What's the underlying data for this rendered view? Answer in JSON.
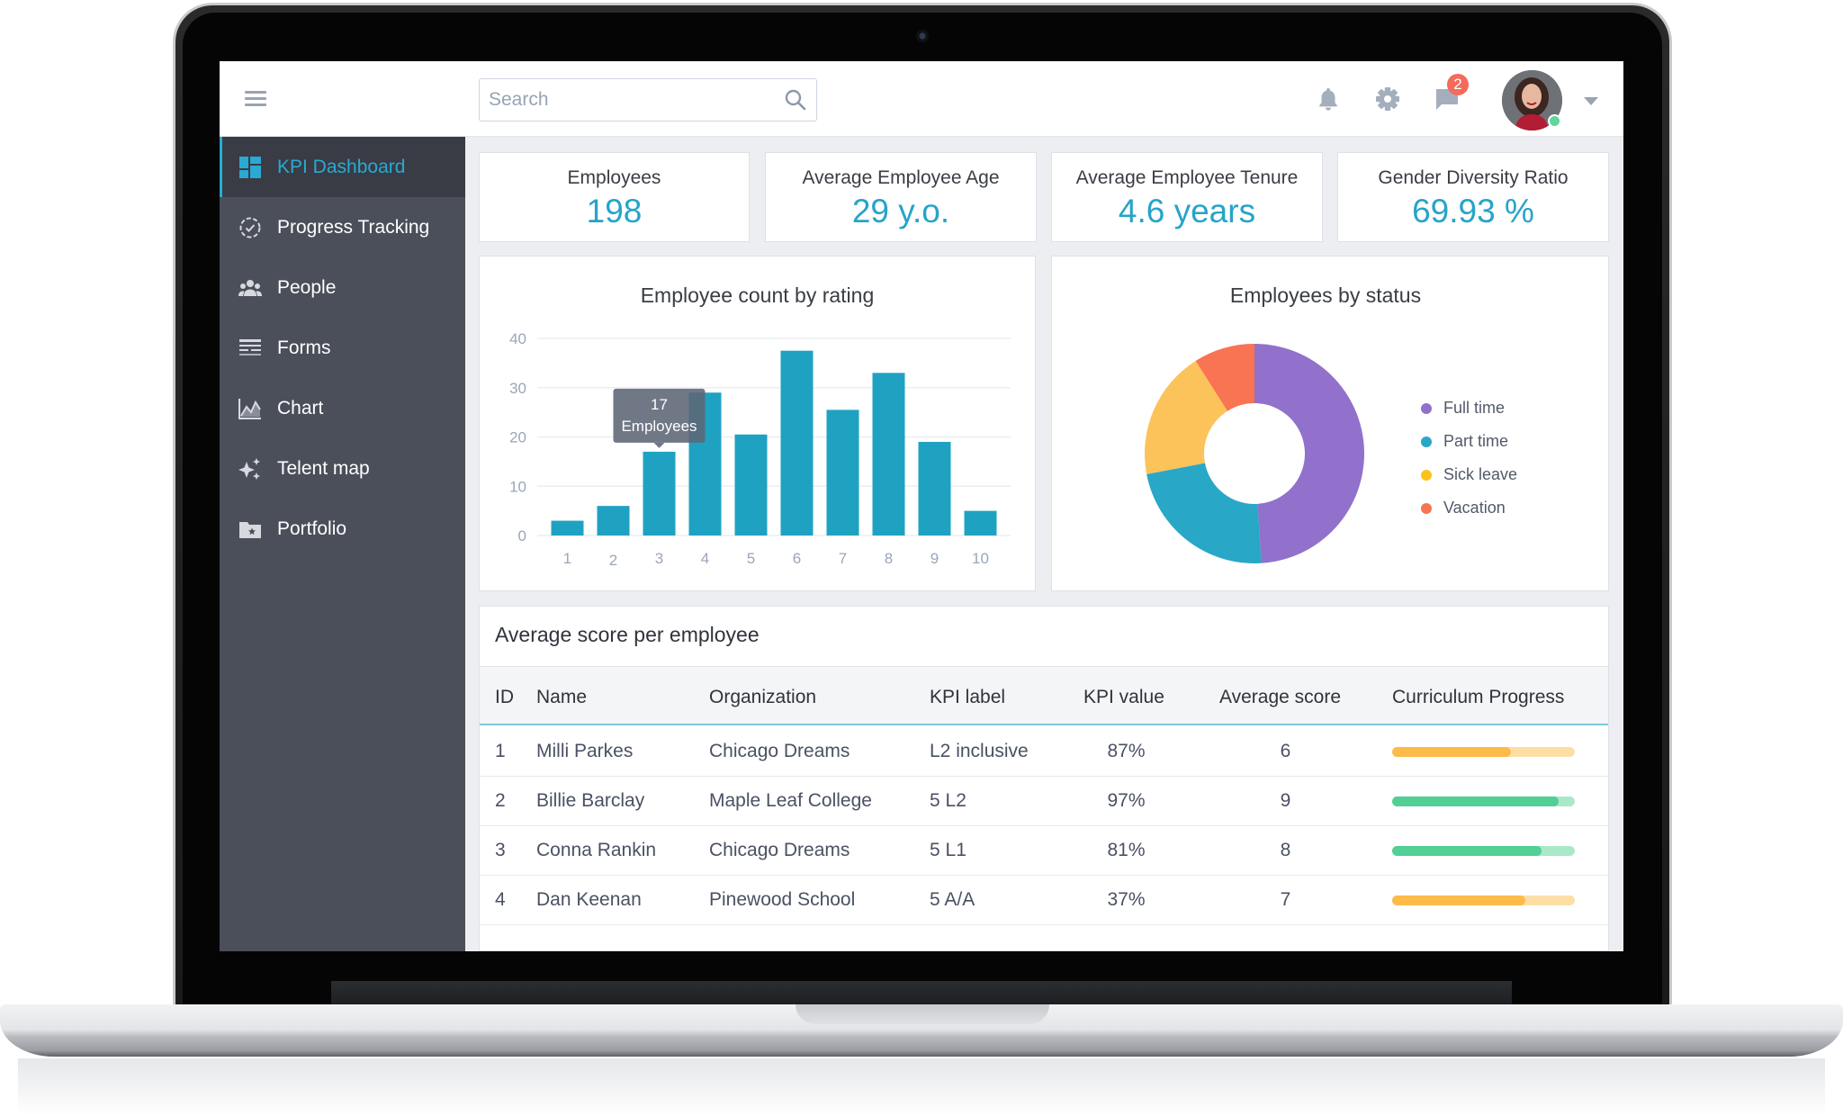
{
  "header": {
    "search_placeholder": "Search",
    "notification_badge": "2",
    "icons": [
      "menu-icon",
      "search-icon",
      "bell-icon",
      "gear-icon",
      "chat-icon",
      "avatar",
      "caret-down-icon"
    ]
  },
  "sidebar": {
    "items": [
      {
        "label": "KPI Dashboard",
        "icon": "dashboard-icon",
        "active": true
      },
      {
        "label": "Progress Tracking",
        "icon": "progress-check-icon",
        "active": false
      },
      {
        "label": "People",
        "icon": "people-icon",
        "active": false
      },
      {
        "label": "Forms",
        "icon": "forms-icon",
        "active": false
      },
      {
        "label": "Chart",
        "icon": "chart-icon",
        "active": false
      },
      {
        "label": "Telent map",
        "icon": "sparkle-icon",
        "active": false
      },
      {
        "label": "Portfolio",
        "icon": "star-folder-icon",
        "active": false
      }
    ]
  },
  "kpis": [
    {
      "label": "Employees",
      "value": "198"
    },
    {
      "label": "Average Employee Age",
      "value": "29 y.o."
    },
    {
      "label": "Average Employee Tenure",
      "value": "4.6 years"
    },
    {
      "label": "Gender Diversity Ratio",
      "value": "69.93 %"
    }
  ],
  "colors": {
    "accent": "#26a4c9",
    "bar": "#1fa2c2",
    "sidebar_bg": "#4b4f5a",
    "sidebar_active_bg": "#393c45",
    "progress_orange": "#fdbb4a",
    "progress_orange_track": "#fddfa6",
    "progress_green": "#51cf95",
    "progress_green_track": "#a9e8c9"
  },
  "chart_data": [
    {
      "type": "bar",
      "title": "Employee count by rating",
      "categories": [
        "1",
        "2",
        "3",
        "4",
        "5",
        "6",
        "7",
        "8",
        "9",
        "10"
      ],
      "values": [
        3,
        6,
        17,
        29,
        20.5,
        37.5,
        25.5,
        33,
        19,
        5
      ],
      "xlabel": "",
      "ylabel": "",
      "ylim": [
        0,
        40
      ],
      "yticks": [
        0,
        10,
        20,
        30,
        40
      ],
      "grid": true,
      "tooltip": {
        "category": "3",
        "value": "17",
        "unit": "Employees"
      }
    },
    {
      "type": "pie",
      "title": "Employees by status",
      "donut": true,
      "labels": [
        "Full time",
        "Part time",
        "Sick leave",
        "Vacation"
      ],
      "values": [
        49,
        23,
        19,
        9
      ],
      "colors": [
        "#9171cb",
        "#29a7c6",
        "#fcc35a",
        "#f87452"
      ],
      "legend": "right"
    }
  ],
  "table": {
    "title": "Average score per employee",
    "columns": [
      "ID",
      "Name",
      "Organization",
      "KPI label",
      "KPI value",
      "Average score",
      "Curriculum Progress"
    ],
    "rows": [
      {
        "id": "1",
        "name": "Milli Parkes",
        "org": "Chicago Dreams",
        "kpi_label": "L2 inclusive",
        "kpi_value": "87%",
        "avg": "6",
        "progress": 0.65,
        "progress_color": "orange"
      },
      {
        "id": "2",
        "name": "Billie Barclay",
        "org": "Maple Leaf College",
        "kpi_label": "5 L2",
        "kpi_value": "97%",
        "avg": "9",
        "progress": 0.91,
        "progress_color": "green"
      },
      {
        "id": "3",
        "name": "Conna Rankin",
        "org": "Chicago Dreams",
        "kpi_label": "5 L1",
        "kpi_value": "81%",
        "avg": "8",
        "progress": 0.82,
        "progress_color": "green"
      },
      {
        "id": "4",
        "name": "Dan Keenan",
        "org": "Pinewood School",
        "kpi_label": "5 A/A",
        "kpi_value": "37%",
        "avg": "7",
        "progress": 0.73,
        "progress_color": "orange"
      }
    ]
  }
}
